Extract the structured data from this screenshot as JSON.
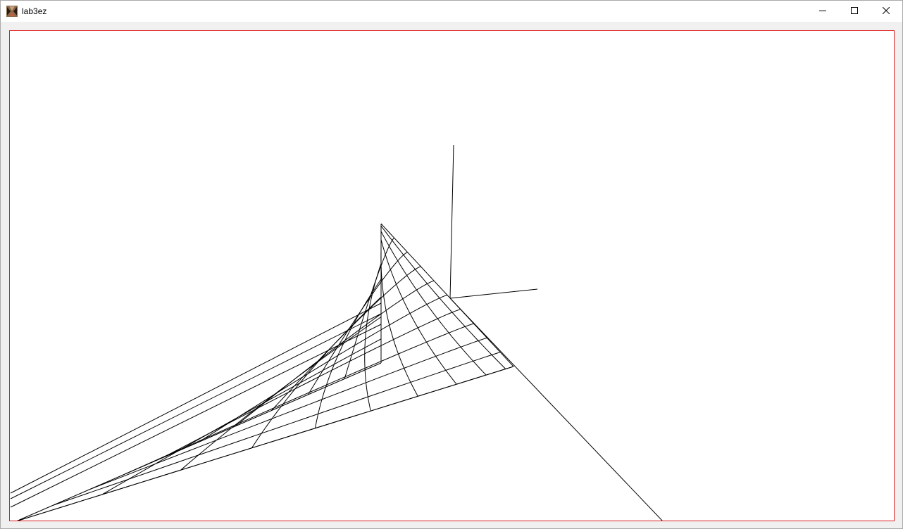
{
  "window": {
    "title": "lab3ez",
    "icon": "app-icon",
    "controls": {
      "minimize_icon": "minimize-icon",
      "maximize_icon": "maximize-icon",
      "close_icon": "close-icon"
    }
  },
  "canvas": {
    "border_color": "#e02020",
    "line_color": "#000000",
    "background_color": "#ffffff"
  }
}
